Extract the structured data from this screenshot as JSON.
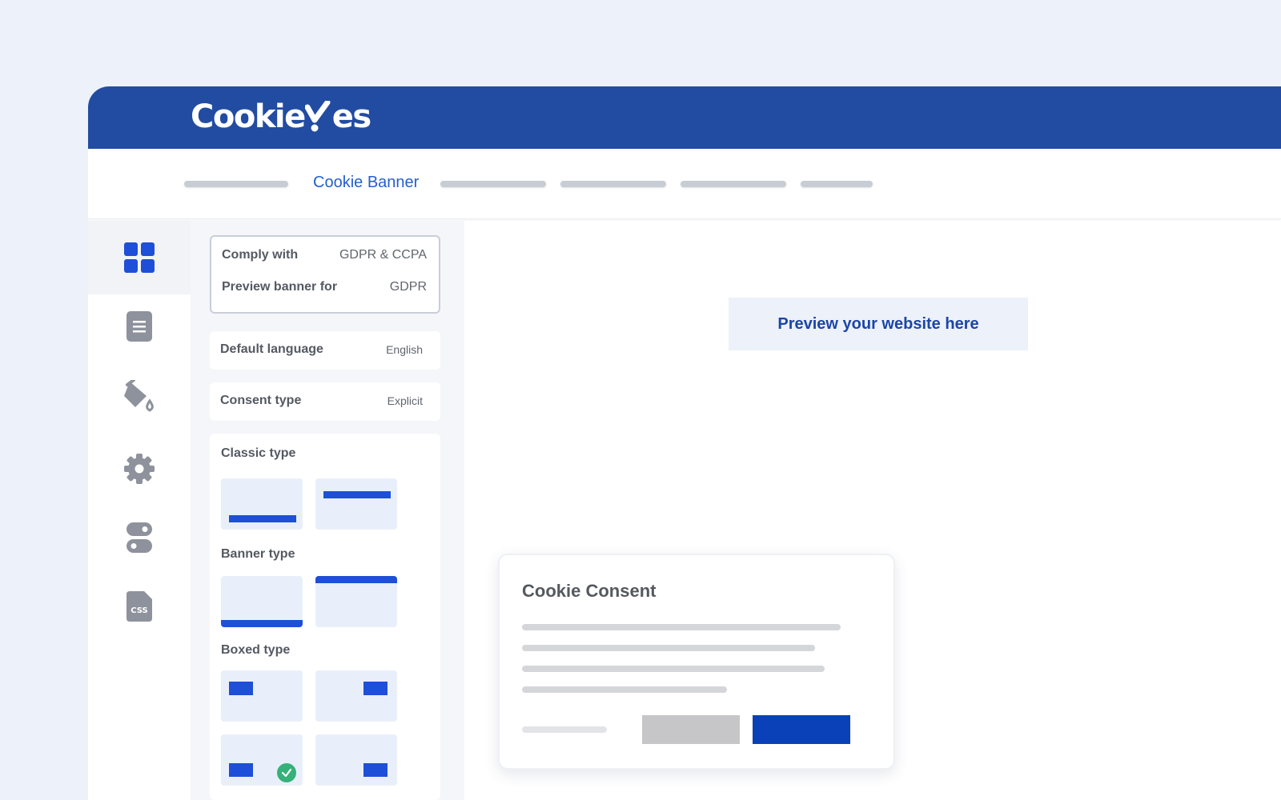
{
  "app": {
    "logo_text": "Cookie·/es",
    "brand_color": "#224ca2",
    "accent_color": "#1e4fd8"
  },
  "nav": {
    "active_tab": "Cookie Banner"
  },
  "sidebar_icons": [
    "dashboard-icon",
    "document-icon",
    "paint-bucket-icon",
    "gear-icon",
    "toggle-icon",
    "css-file-icon"
  ],
  "settings": {
    "comply_with_label": "Comply with",
    "comply_with_value": "GDPR & CCPA",
    "preview_for_label": "Preview banner for",
    "preview_for_value": "GDPR",
    "language_label": "Default language",
    "language_value": "English",
    "consent_label": "Consent type",
    "consent_value": "Explicit",
    "classic_label": "Classic type",
    "banner_label": "Banner type",
    "boxed_label": "Boxed type"
  },
  "preview": {
    "placeholder_text": "Preview your website here",
    "consent_title": "Cookie Consent"
  }
}
